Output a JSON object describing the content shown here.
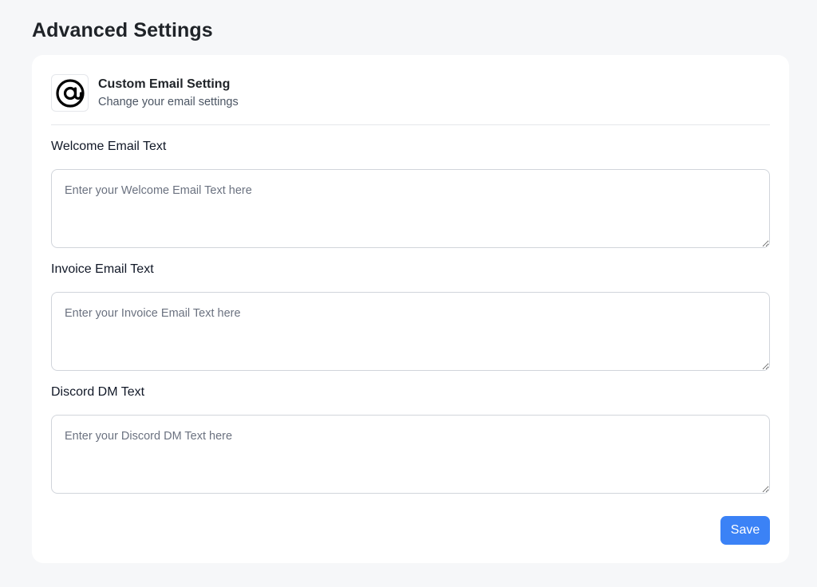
{
  "page": {
    "title": "Advanced Settings"
  },
  "section": {
    "icon": "at-sign-icon",
    "title": "Custom Email Setting",
    "subtitle": "Change your email settings"
  },
  "fields": [
    {
      "label": "Welcome Email Text",
      "value": "",
      "placeholder": "Enter your Welcome Email Text here"
    },
    {
      "label": "Invoice Email Text",
      "value": "",
      "placeholder": "Enter your Invoice Email Text here"
    },
    {
      "label": "Discord DM Text",
      "value": "",
      "placeholder": "Enter your Discord DM Text here"
    }
  ],
  "actions": {
    "save_label": "Save"
  },
  "colors": {
    "accent": "#3b82f6",
    "background": "#f6f7f9",
    "card": "#ffffff"
  }
}
